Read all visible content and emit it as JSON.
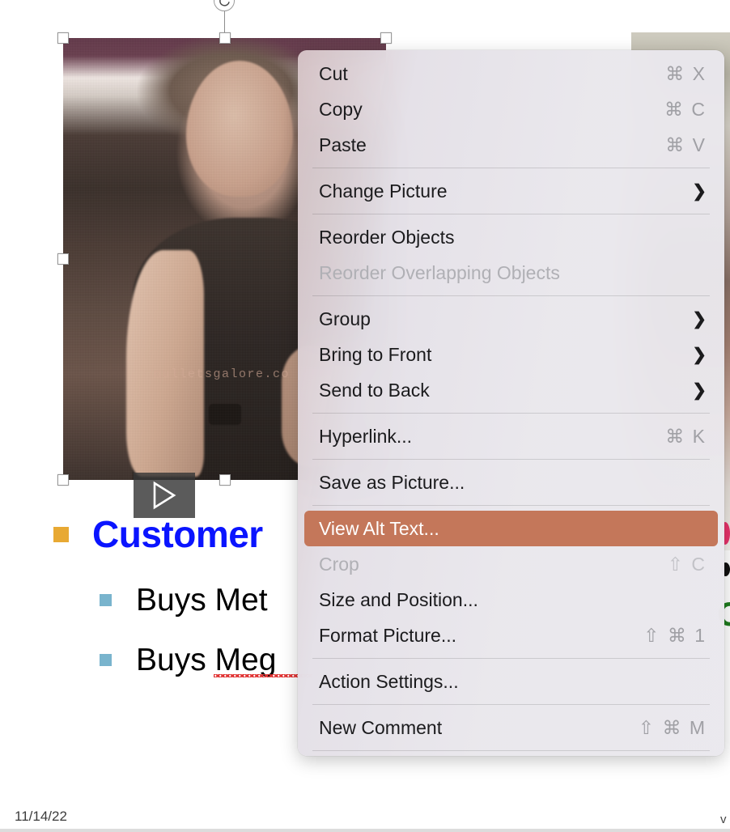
{
  "slide": {
    "date": "11/14/22",
    "bullets": [
      {
        "level": 1,
        "marker_color": "#e8a933",
        "text": "Customer",
        "text_color": "#0a14ff",
        "bold": true
      },
      {
        "level": 2,
        "marker_color": "#79b4cd",
        "text": "Buys Met",
        "text_color": "#000000",
        "bold": false
      },
      {
        "level": 2,
        "marker_color": "#79b4cd",
        "text": "Buys Meg",
        "text_color": "#000000",
        "bold": false,
        "misspelled": true
      }
    ],
    "picture": {
      "watermark": "mulletsgalore.co",
      "play_icon": "play-triangle-icon",
      "rotate_icon": "rotate-handle-icon",
      "selected": true,
      "handle_count": 8
    },
    "edge_fragment": "v"
  },
  "context_menu": {
    "groups": [
      {
        "items": [
          {
            "label": "Cut",
            "shortcut": "⌘ X",
            "state": "normal",
            "submenu": false
          },
          {
            "label": "Copy",
            "shortcut": "⌘ C",
            "state": "normal",
            "submenu": false
          },
          {
            "label": "Paste",
            "shortcut": "⌘ V",
            "state": "normal",
            "submenu": false
          }
        ]
      },
      {
        "items": [
          {
            "label": "Change Picture",
            "shortcut": "",
            "state": "normal",
            "submenu": true
          }
        ]
      },
      {
        "items": [
          {
            "label": "Reorder Objects",
            "shortcut": "",
            "state": "normal",
            "submenu": false
          },
          {
            "label": "Reorder Overlapping Objects",
            "shortcut": "",
            "state": "disabled",
            "submenu": false
          }
        ]
      },
      {
        "items": [
          {
            "label": "Group",
            "shortcut": "",
            "state": "normal",
            "submenu": true
          },
          {
            "label": "Bring to Front",
            "shortcut": "",
            "state": "normal",
            "submenu": true
          },
          {
            "label": "Send to Back",
            "shortcut": "",
            "state": "normal",
            "submenu": true
          }
        ]
      },
      {
        "items": [
          {
            "label": "Hyperlink...",
            "shortcut": "⌘ K",
            "state": "normal",
            "submenu": false
          }
        ]
      },
      {
        "items": [
          {
            "label": "Save as Picture...",
            "shortcut": "",
            "state": "normal",
            "submenu": false
          }
        ]
      },
      {
        "items": [
          {
            "label": "View Alt Text...",
            "shortcut": "",
            "state": "selected",
            "submenu": false
          },
          {
            "label": "Crop",
            "shortcut": "⇧ C",
            "state": "disabled",
            "submenu": false
          },
          {
            "label": "Size and Position...",
            "shortcut": "",
            "state": "normal",
            "submenu": false
          },
          {
            "label": "Format Picture...",
            "shortcut": "⇧ ⌘ 1",
            "state": "normal",
            "submenu": false
          }
        ]
      },
      {
        "items": [
          {
            "label": "Action Settings...",
            "shortcut": "",
            "state": "normal",
            "submenu": false
          }
        ]
      },
      {
        "items": [
          {
            "label": "New Comment",
            "shortcut": "⇧ ⌘ M",
            "state": "normal",
            "submenu": false
          }
        ]
      }
    ],
    "highlight_color": "#c4775a",
    "submenu_icon": "chevron-right-icon"
  }
}
